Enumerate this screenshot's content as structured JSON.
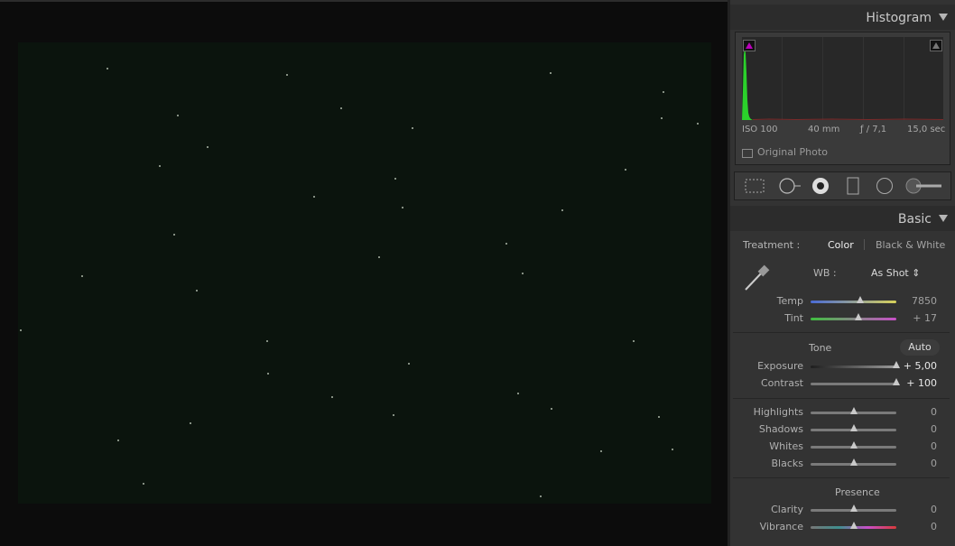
{
  "histogram": {
    "title": "Histogram",
    "exif": {
      "iso": "ISO 100",
      "focal": "40 mm",
      "aperture": "ƒ / 7,1",
      "shutter": "15,0 sec"
    },
    "original_photo_label": "Original Photo"
  },
  "tools": [
    "crop-overlay-icon",
    "spot-removal-icon",
    "red-eye-icon",
    "graduated-filter-icon",
    "radial-filter-icon",
    "adjustment-brush-icon"
  ],
  "basic": {
    "title": "Basic",
    "treatment_label": "Treatment :",
    "treatment_color": "Color",
    "treatment_bw": "Black & White",
    "wb_label": "WB :",
    "wb_value": "As Shot ⇕",
    "temp": {
      "label": "Temp",
      "value": "7850",
      "level": 0.58
    },
    "tint": {
      "label": "Tint",
      "value": "+ 17",
      "level": 0.56
    },
    "tone_label": "Tone",
    "auto_label": "Auto",
    "exposure": {
      "label": "Exposure",
      "value": "+ 5,00",
      "level": 1.0
    },
    "contrast": {
      "label": "Contrast",
      "value": "+ 100",
      "level": 1.0
    },
    "highlights": {
      "label": "Highlights",
      "value": "0",
      "level": 0.5
    },
    "shadows": {
      "label": "Shadows",
      "value": "0",
      "level": 0.5
    },
    "whites": {
      "label": "Whites",
      "value": "0",
      "level": 0.5
    },
    "blacks": {
      "label": "Blacks",
      "value": "0",
      "level": 0.5
    },
    "presence_label": "Presence",
    "clarity": {
      "label": "Clarity",
      "value": "0",
      "level": 0.5
    },
    "vibrance": {
      "label": "Vibrance",
      "value": "0",
      "level": 0.5
    }
  },
  "colors": {
    "panel_bg": "#333333",
    "photo_bg": "#0b140d",
    "clip_shadow": "#bb00bb",
    "histogram_green": "#2bd12b"
  }
}
